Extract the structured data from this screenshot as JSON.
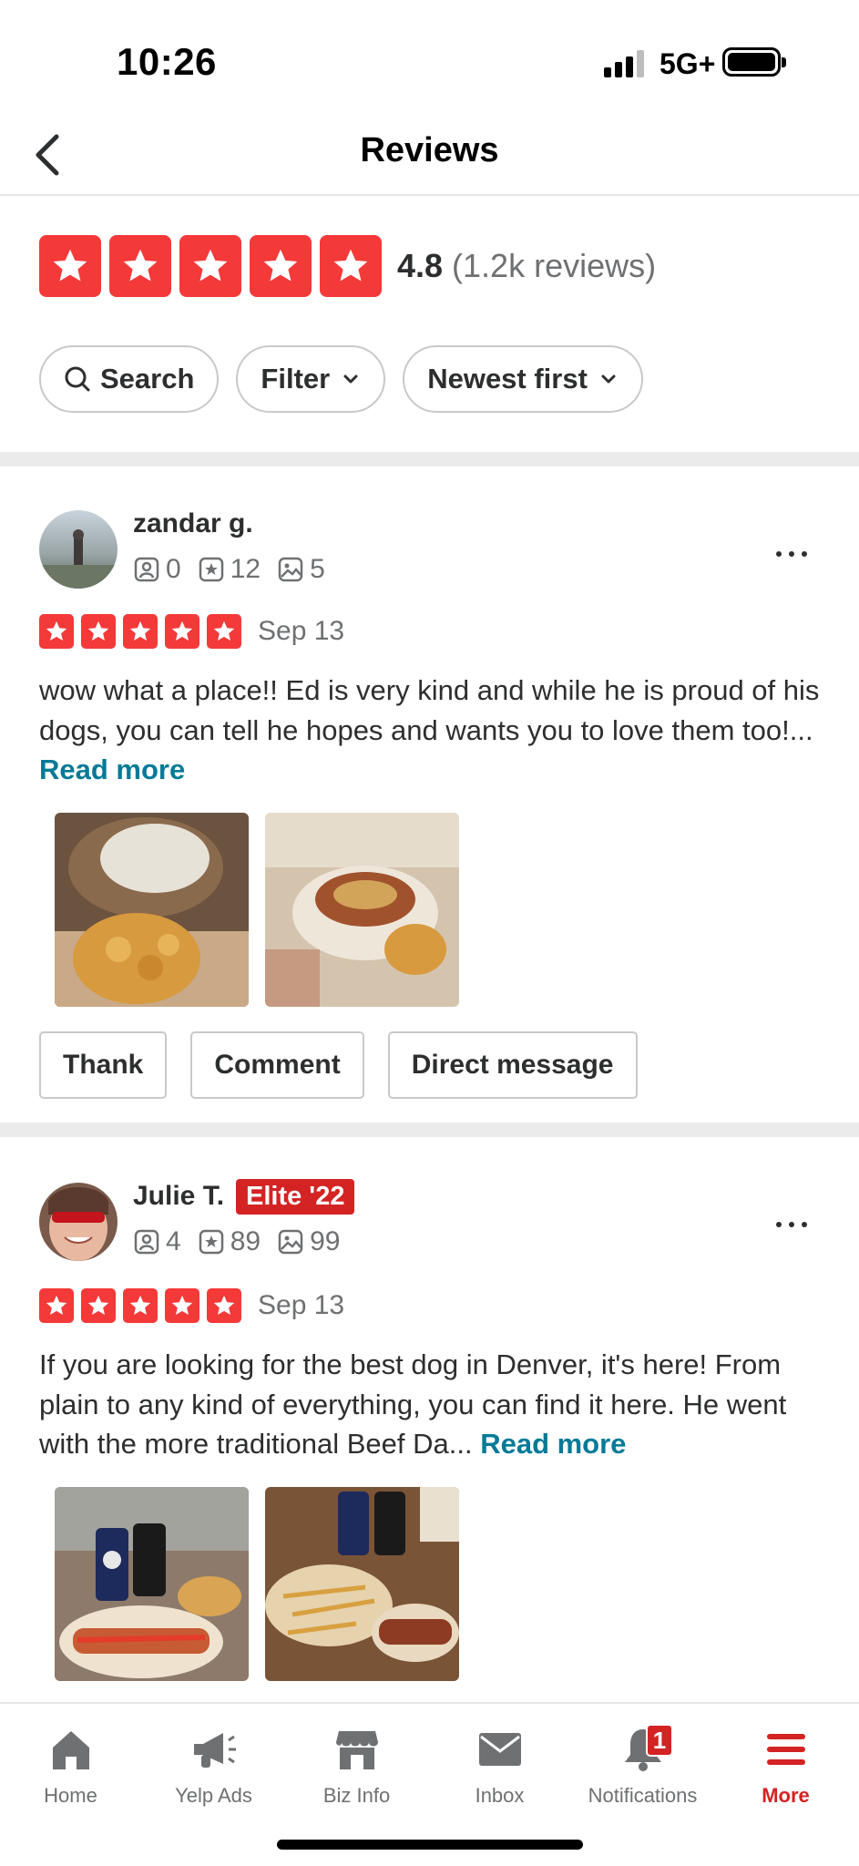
{
  "status_bar": {
    "time": "10:26",
    "network": "5G+"
  },
  "nav": {
    "title": "Reviews"
  },
  "summary": {
    "rating": "4.8",
    "count": "(1.2k reviews)",
    "stars": 5,
    "star_color": "#f43939"
  },
  "controls": {
    "search": "Search",
    "filter": "Filter",
    "sort": "Newest first"
  },
  "reviews": [
    {
      "name": "zandar g.",
      "friends": "0",
      "reviews": "12",
      "photos": "5",
      "stars": 5,
      "date": "Sep 13",
      "text": "wow what a place!! Ed is very kind and while he is proud of his dogs, you can tell he hopes and wants you to love them too!...",
      "read_more": "Read more",
      "actions": [
        "Thank",
        "Comment",
        "Direct message"
      ]
    },
    {
      "name": "Julie T.",
      "elite": "Elite '22",
      "friends": "4",
      "reviews": "89",
      "photos": "99",
      "stars": 5,
      "date": "Sep 13",
      "text": "If you are looking for the best dog in Denver, it's here! From plain to any kind of everything, you can find it here. He went with the more traditional Beef Da...",
      "read_more": "Read more"
    }
  ],
  "tabs": [
    {
      "label": "Home",
      "icon": "home-icon"
    },
    {
      "label": "Yelp Ads",
      "icon": "megaphone-icon"
    },
    {
      "label": "Biz Info",
      "icon": "storefront-icon"
    },
    {
      "label": "Inbox",
      "icon": "mail-icon"
    },
    {
      "label": "Notifications",
      "icon": "bell-icon",
      "badge": "1"
    },
    {
      "label": "More",
      "icon": "menu-icon",
      "active": true
    }
  ],
  "colors": {
    "accent": "#d32323",
    "link": "#027a97"
  }
}
